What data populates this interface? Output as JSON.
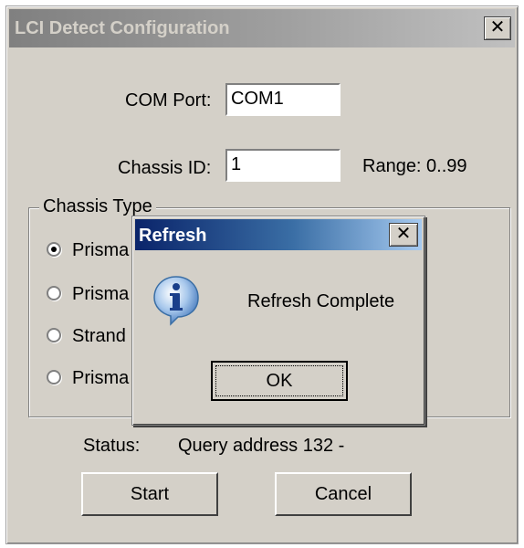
{
  "window": {
    "title": "LCI Detect Configuration",
    "close_glyph": "✕"
  },
  "form": {
    "com_port_label": "COM Port:",
    "com_port_value": "COM1",
    "chassis_id_label": "Chassis ID:",
    "chassis_id_value": "1",
    "range_label": "Range: 0..99"
  },
  "chassis_type": {
    "legend": "Chassis Type",
    "options": [
      {
        "label": "Prisma",
        "selected": true
      },
      {
        "label": "Prisma",
        "selected": false
      },
      {
        "label": "Strand",
        "selected": false
      },
      {
        "label": "Prisma",
        "selected": false
      }
    ]
  },
  "status": {
    "label": "Status:",
    "value": "Query address 132 -"
  },
  "buttons": {
    "start": "Start",
    "cancel": "Cancel"
  },
  "dialog": {
    "title": "Refresh",
    "message": "Refresh Complete",
    "ok": "OK",
    "icon": "info-icon",
    "close_glyph": "✕"
  }
}
